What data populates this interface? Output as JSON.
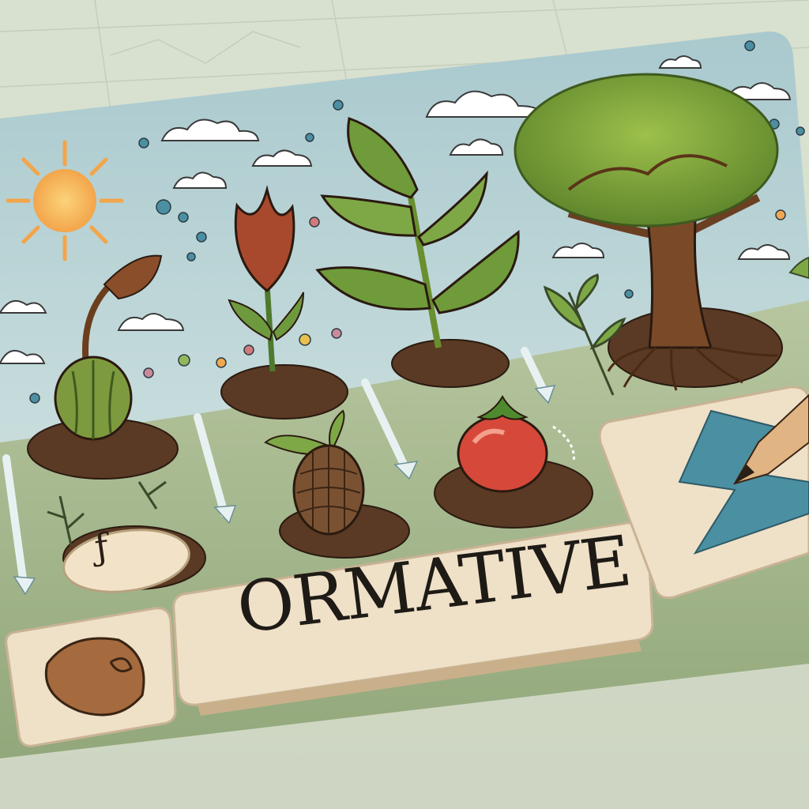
{
  "image": {
    "tile_word": "ORMATIVE",
    "stone_glyph": "ƒ",
    "stages": [
      "sprouting-seed",
      "tulip-bud",
      "leafy-stem",
      "pine-cone-sprout",
      "tomato",
      "mature-tree"
    ]
  },
  "colors": {
    "sky": "#cfe1e4",
    "grass": "#9fb28a",
    "soil": "#5a3a24",
    "tile": "#efe0c8",
    "accent_teal": "#4b8fa2",
    "sun": "#f6b74a",
    "tree_canopy": "#7ea13a"
  }
}
